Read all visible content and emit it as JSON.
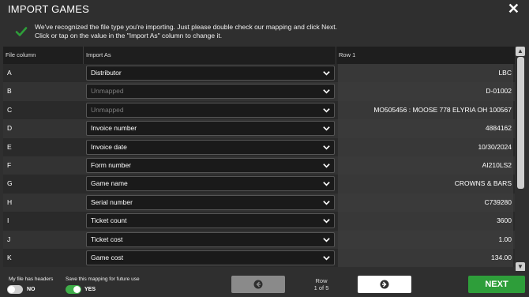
{
  "dialog": {
    "title": "IMPORT GAMES",
    "close_icon": "close-icon"
  },
  "notice": {
    "line1": "We've recognized the file type you're importing. Just please double check our mapping and click Next.",
    "line2": "Click or tap on the value in the \"Import As\" column to change it.",
    "icon": "checkmark-icon",
    "icon_color": "#2e9e3a"
  },
  "table": {
    "headers": [
      "File column",
      "Import As",
      "Row 1"
    ],
    "rows": [
      {
        "col": "A",
        "import_as": "Distributor",
        "mapped": true,
        "value": "LBC"
      },
      {
        "col": "B",
        "import_as": "Unmapped",
        "mapped": false,
        "value": "D-01002"
      },
      {
        "col": "C",
        "import_as": "Unmapped",
        "mapped": false,
        "value": "MO505456 : MOOSE 778 ELYRIA OH 100567"
      },
      {
        "col": "D",
        "import_as": "Invoice number",
        "mapped": true,
        "value": "4884162"
      },
      {
        "col": "E",
        "import_as": "Invoice date",
        "mapped": true,
        "value": "10/30/2024"
      },
      {
        "col": "F",
        "import_as": "Form number",
        "mapped": true,
        "value": "AI210LS2"
      },
      {
        "col": "G",
        "import_as": "Game name",
        "mapped": true,
        "value": "CROWNS & BARS"
      },
      {
        "col": "H",
        "import_as": "Serial number",
        "mapped": true,
        "value": "C739280"
      },
      {
        "col": "I",
        "import_as": "Ticket count",
        "mapped": true,
        "value": "3600"
      },
      {
        "col": "J",
        "import_as": "Ticket cost",
        "mapped": true,
        "value": "1.00"
      },
      {
        "col": "K",
        "import_as": "Game cost",
        "mapped": true,
        "value": "134.00"
      }
    ]
  },
  "footer": {
    "headers_label": "My file has headers",
    "headers_toggle_text": "NO",
    "headers_toggle_on": false,
    "save_label": "Save this mapping for future use",
    "save_toggle_text": "YES",
    "save_toggle_on": true,
    "row_label": "Row",
    "row_position": "1 of 5",
    "next_label": "NEXT",
    "toggle_on_color": "#3fae49",
    "next_color": "#2e9e3a"
  }
}
